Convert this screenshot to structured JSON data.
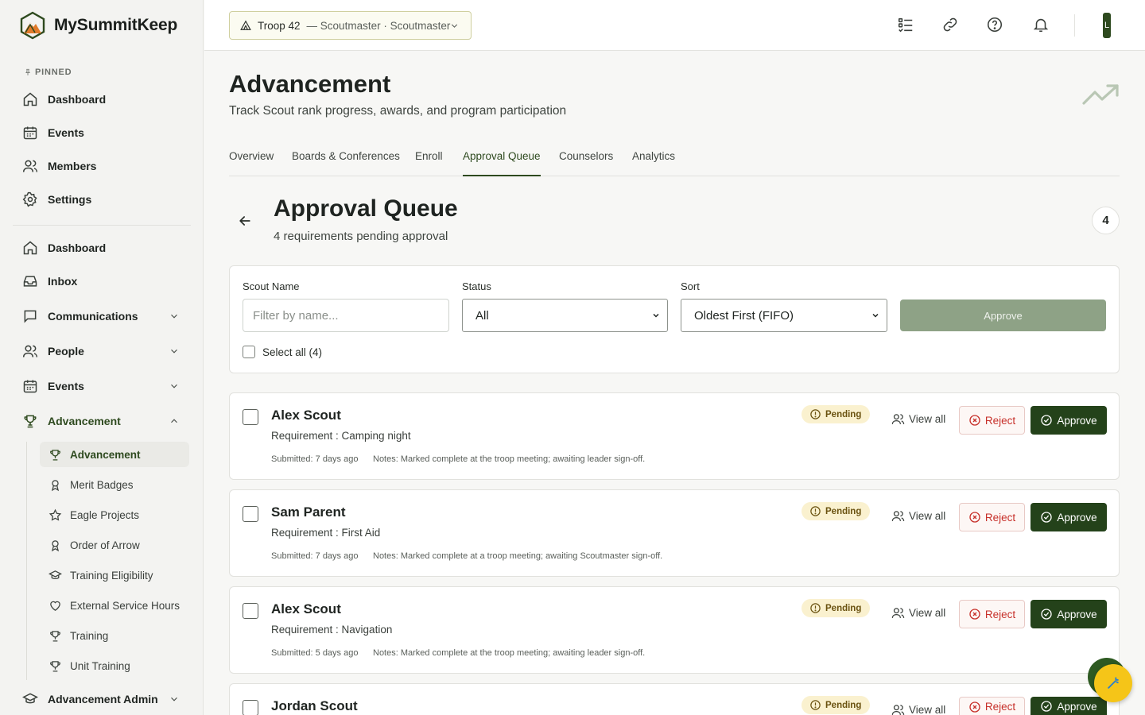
{
  "brand": {
    "name": "MySummitKeep"
  },
  "sidebar": {
    "pinned_label": "PINNED",
    "pinned": [
      {
        "label": "Dashboard",
        "icon": "home-icon"
      },
      {
        "label": "Events",
        "icon": "calendar-icon"
      },
      {
        "label": "Members",
        "icon": "users-icon"
      },
      {
        "label": "Settings",
        "icon": "gear-icon"
      }
    ],
    "main": [
      {
        "label": "Dashboard",
        "icon": "home-icon"
      },
      {
        "label": "Inbox",
        "icon": "inbox-icon"
      },
      {
        "label": "Communications",
        "icon": "chat-icon",
        "expandable": true
      },
      {
        "label": "People",
        "icon": "users-icon",
        "expandable": true
      },
      {
        "label": "Events",
        "icon": "calendar-icon",
        "expandable": true
      },
      {
        "label": "Advancement",
        "icon": "trophy-icon",
        "expandable": true,
        "expanded": true
      },
      {
        "label": "Advancement Admin",
        "icon": "graduation-cap-icon",
        "expandable": true
      }
    ],
    "advancement_sub": [
      {
        "label": "Advancement",
        "icon": "trophy-icon",
        "active": true
      },
      {
        "label": "Merit Badges",
        "icon": "award-icon"
      },
      {
        "label": "Eagle Projects",
        "icon": "star-icon"
      },
      {
        "label": "Order of Arrow",
        "icon": "award-icon"
      },
      {
        "label": "Training Eligibility",
        "icon": "graduation-cap-icon"
      },
      {
        "label": "External Service Hours",
        "icon": "heart-icon"
      },
      {
        "label": "Training",
        "icon": "trophy-icon"
      },
      {
        "label": "Unit Training",
        "icon": "trophy-icon"
      }
    ]
  },
  "topbar": {
    "troop": "Troop 42",
    "troop_role": "— Scoutmaster · Scoutmaster",
    "avatar_initial": "L"
  },
  "page": {
    "title": "Advancement",
    "subtitle": "Track Scout rank progress, awards, and program participation"
  },
  "tabs": [
    {
      "label": "Overview"
    },
    {
      "label": "Boards & Conferences"
    },
    {
      "label": "Enroll"
    },
    {
      "label": "Approval Queue",
      "active": true
    },
    {
      "label": "Counselors"
    },
    {
      "label": "Analytics"
    }
  ],
  "queue": {
    "title": "Approval Queue",
    "subtitle": "4 requirements pending approval",
    "count": "4"
  },
  "filters": {
    "scout_name_label": "Scout Name",
    "scout_name_placeholder": "Filter by name...",
    "status_label": "Status",
    "status_value": "All",
    "sort_label": "Sort",
    "sort_value": "Oldest First (FIFO)",
    "approve_label": "Approve",
    "select_all_label": "Select all (4)"
  },
  "requests": [
    {
      "name": "Alex Scout",
      "requirement": "Requirement : Camping night",
      "submitted": "Submitted: 7 days ago",
      "notes": "Notes: Marked complete at the troop meeting; awaiting leader sign-off.",
      "status": "Pending"
    },
    {
      "name": "Sam Parent",
      "requirement": "Requirement : First Aid",
      "submitted": "Submitted: 7 days ago",
      "notes": "Notes: Marked complete at a troop meeting; awaiting Scoutmaster sign-off.",
      "status": "Pending"
    },
    {
      "name": "Alex Scout",
      "requirement": "Requirement : Navigation",
      "submitted": "Submitted: 5 days ago",
      "notes": "Notes: Marked complete at the troop meeting; awaiting leader sign-off.",
      "status": "Pending"
    },
    {
      "name": "Jordan Scout",
      "requirement": "",
      "submitted": "",
      "notes": "",
      "status": "Pending"
    }
  ],
  "actions": {
    "view_all": "View all",
    "reject": "Reject",
    "approve": "Approve"
  },
  "colors": {
    "accent": "#2e4a1f",
    "approve_button": "#24421a",
    "reject_text": "#c7302a",
    "pending_bg": "#faf1cf",
    "fab": "#f5c518"
  }
}
